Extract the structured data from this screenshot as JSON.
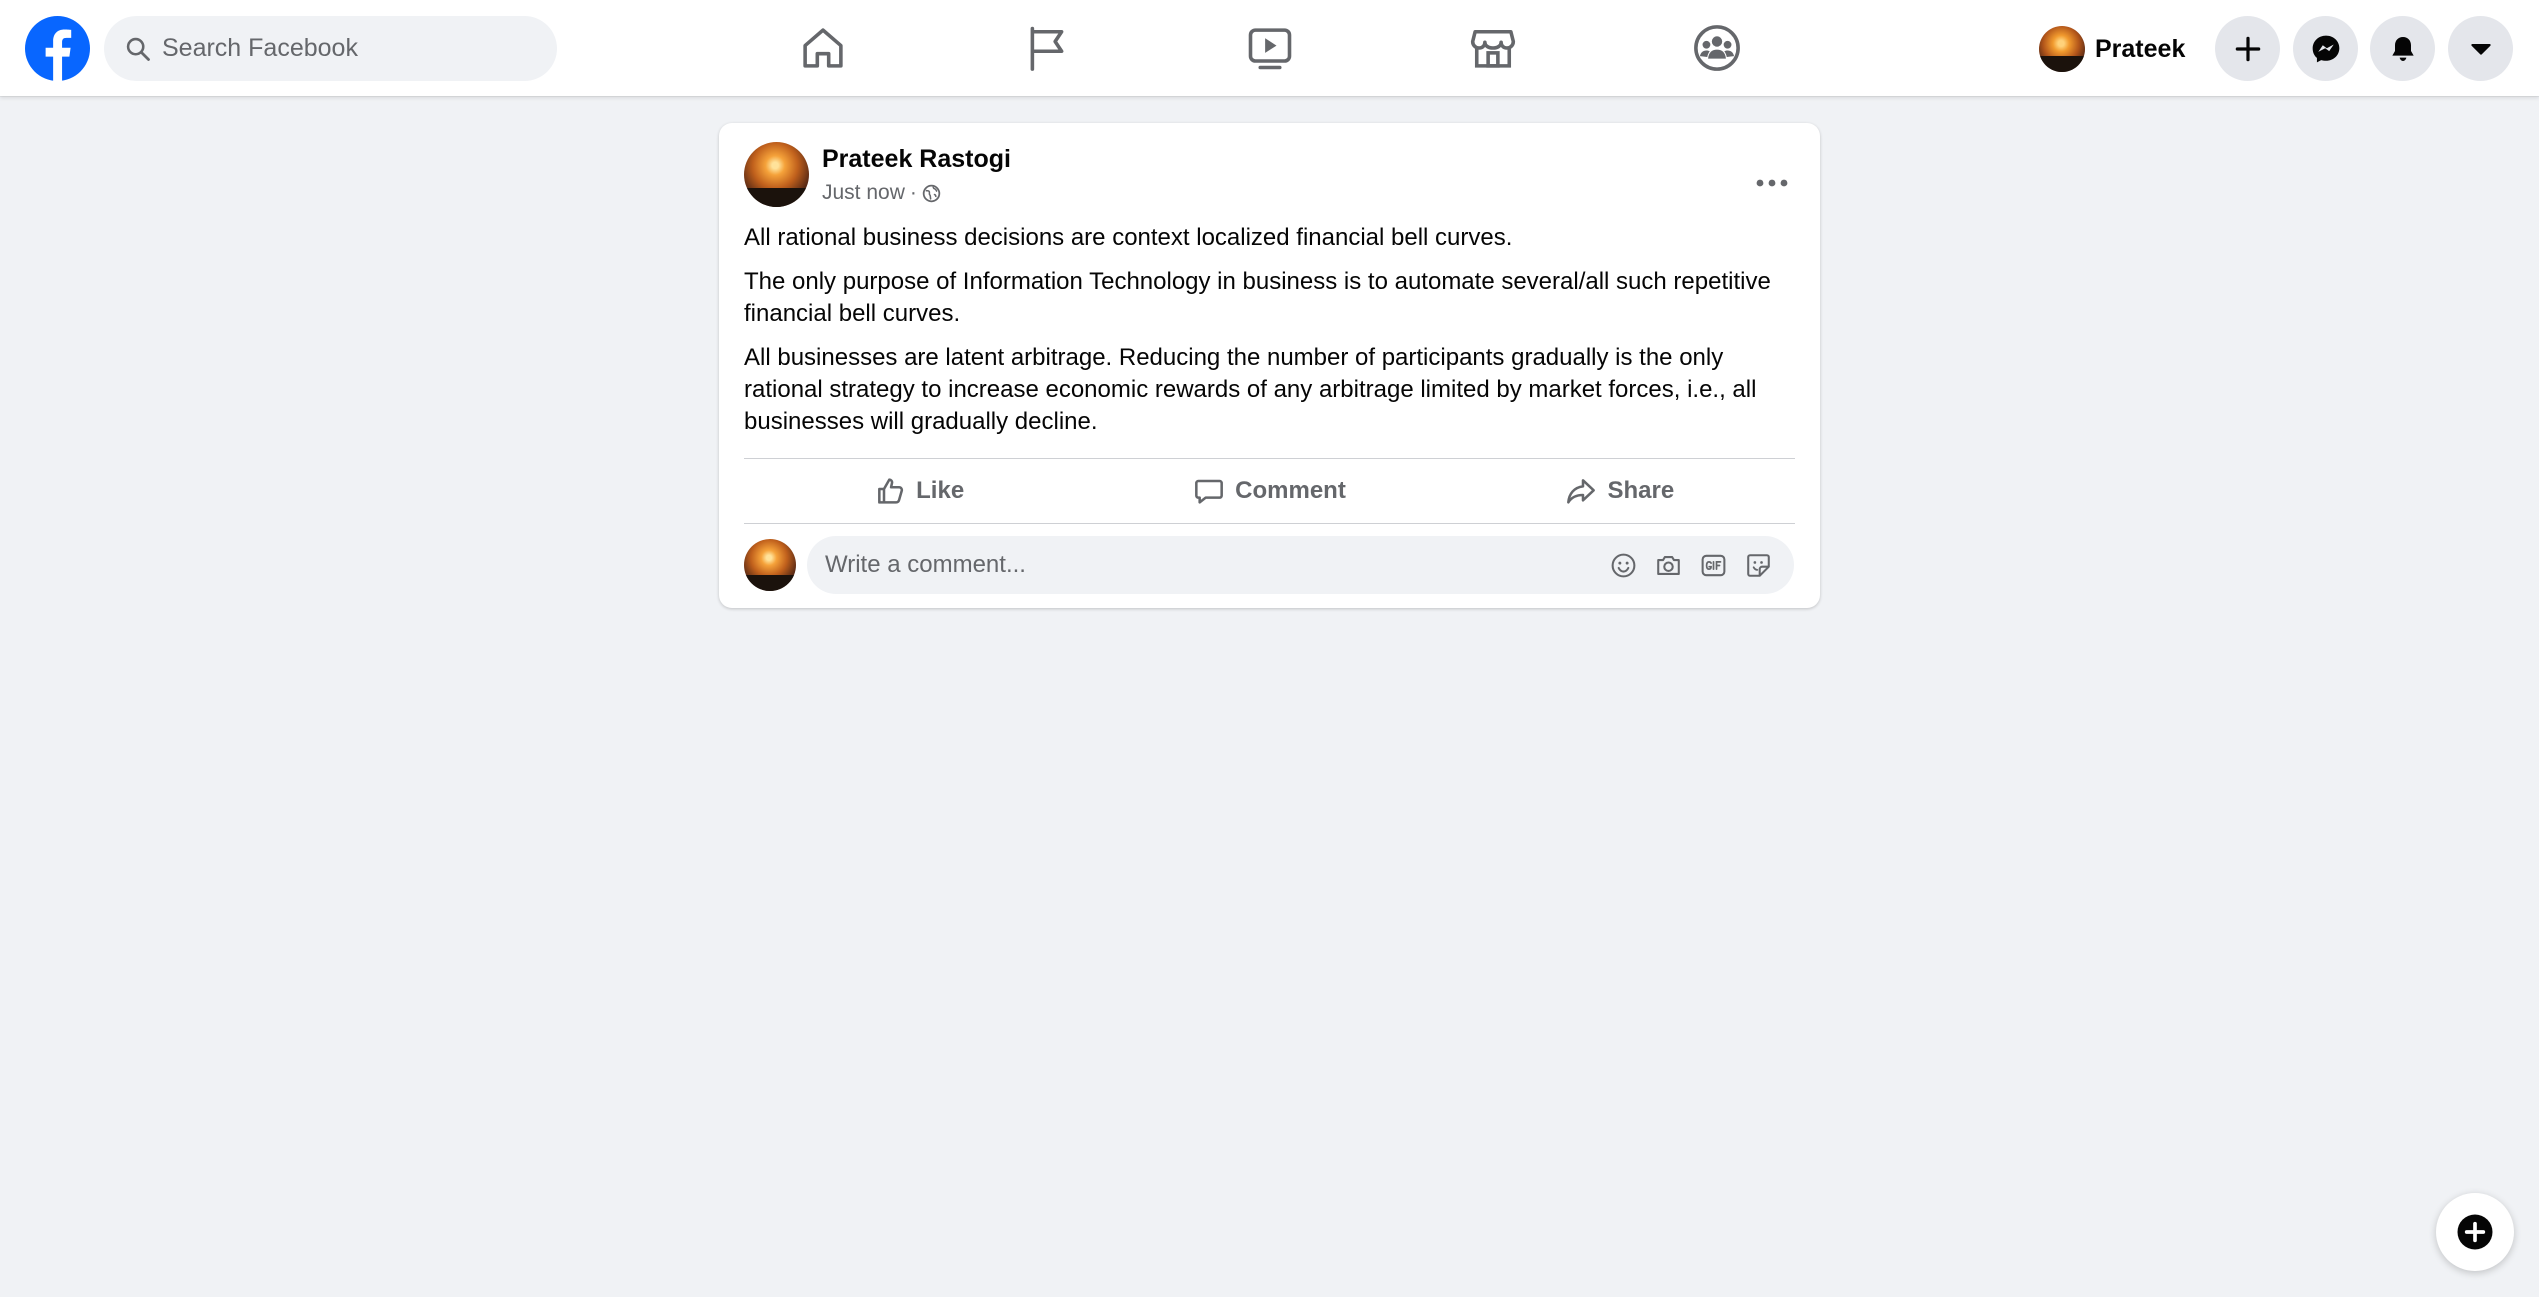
{
  "header": {
    "logo_icon": "facebook-logo-icon",
    "search": {
      "placeholder": "Search Facebook"
    },
    "nav": [
      {
        "icon": "home-icon"
      },
      {
        "icon": "pages-flag-icon"
      },
      {
        "icon": "watch-video-icon"
      },
      {
        "icon": "marketplace-store-icon"
      },
      {
        "icon": "groups-icon"
      }
    ],
    "profile": {
      "name": "Prateek"
    },
    "actions": [
      {
        "icon": "create-plus-icon"
      },
      {
        "icon": "messenger-icon"
      },
      {
        "icon": "notifications-bell-icon"
      },
      {
        "icon": "account-menu-chevron-icon"
      }
    ]
  },
  "post": {
    "author": "Prateek Rastogi",
    "timestamp": "Just now",
    "separator": "·",
    "audience_icon": "public-globe-icon",
    "paragraphs": [
      "All rational business decisions are context localized financial bell curves.",
      "The only purpose of Information Technology in business is to automate several/all such repetitive financial bell curves.",
      "All businesses are latent arbitrage. Reducing the number of participants gradually is the only rational strategy to increase economic rewards of any arbitrage limited by market forces, i.e., all businesses will gradually decline."
    ],
    "actions": {
      "like": "Like",
      "comment": "Comment",
      "share": "Share"
    },
    "comment_box": {
      "placeholder": "Write a comment...",
      "icons": [
        "emoji-icon",
        "camera-icon",
        "gif-icon",
        "sticker-icon"
      ]
    }
  },
  "colors": {
    "brand": "#0866ff",
    "background": "#f0f2f5",
    "secondary_text": "#65676b"
  },
  "floating": {
    "icon": "new-message-icon"
  }
}
